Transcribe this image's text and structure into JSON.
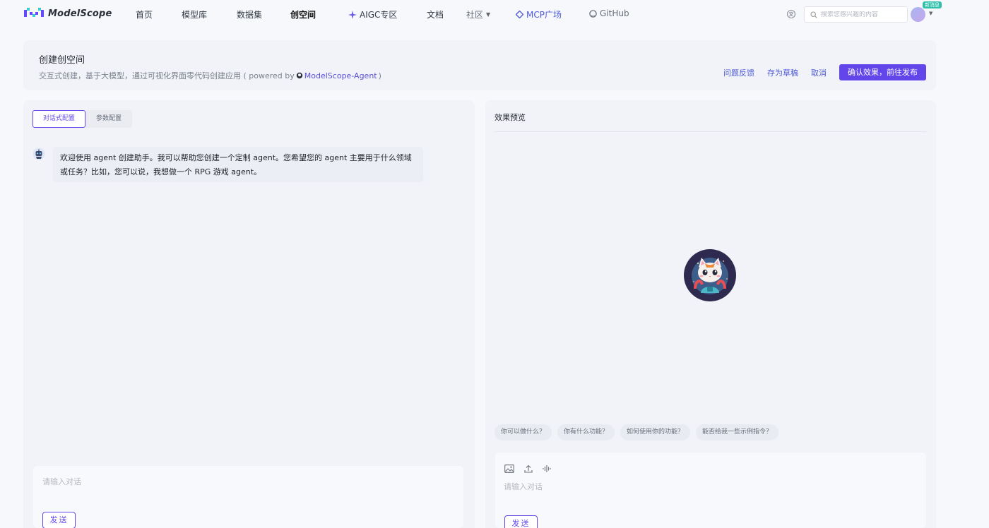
{
  "nav": {
    "brand": "ModelScope",
    "items": [
      {
        "label": "首页"
      },
      {
        "label": "模型库"
      },
      {
        "label": "数据集"
      },
      {
        "label": "创空间"
      },
      {
        "label": "AIGC专区"
      },
      {
        "label": "文档"
      },
      {
        "label": "社区"
      },
      {
        "label": "MCP广场"
      },
      {
        "label": "GitHub"
      }
    ],
    "search_placeholder": "搜索您感兴趣的内容",
    "badge": "新消息"
  },
  "header": {
    "title": "创建创空间",
    "subtitle_prefix": "交互式创建，基于大模型，通过可视化界面零代码创建应用 ( powered by",
    "subtitle_link": "ModelScope-Agent",
    "subtitle_suffix": ")",
    "actions": {
      "feedback": "问题反馈",
      "save_draft": "存为草稿",
      "cancel": "取消",
      "confirm": "确认效果，前往发布"
    }
  },
  "config_panel": {
    "tabs": [
      {
        "label": "对话式配置",
        "active": true
      },
      {
        "label": "参数配置",
        "active": false
      }
    ],
    "welcome_message": "欢迎使用 agent 创建助手。我可以帮助您创建一个定制 agent。您希望您的 agent 主要用于什么领域或任务？比如，您可以说，我想做一个 RPG 游戏 agent。",
    "input_placeholder": "请输入对话",
    "send_label": "发送"
  },
  "preview_panel": {
    "title": "效果预览",
    "suggestions": [
      "你可以做什么？",
      "你有什么功能？",
      "如何使用你的功能？",
      "能否给我一些示例指令？"
    ],
    "input_placeholder": "请输入对话",
    "send_label": "发送",
    "tools": [
      "image-icon",
      "upload-icon",
      "audio-icon"
    ]
  },
  "colors": {
    "accent": "#6246ea",
    "link": "#4e5bd6",
    "badge": "#2fbfa8"
  }
}
